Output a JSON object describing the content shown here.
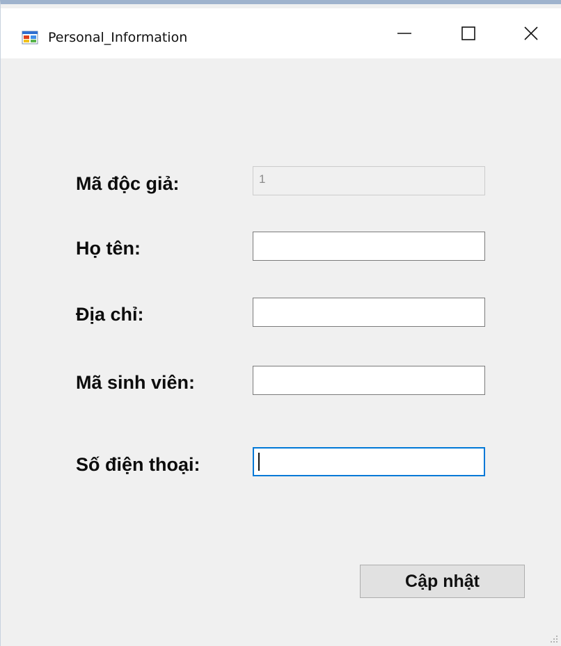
{
  "window": {
    "title": "Personal_Information",
    "app_icon": "winforms-app-icon",
    "controls": {
      "minimize": "minimize-icon",
      "maximize": "maximize-icon",
      "close": "close-icon"
    }
  },
  "form": {
    "fields": [
      {
        "label": "Mã độc giả:",
        "value": "1",
        "enabled": false
      },
      {
        "label": "Họ tên:",
        "value": "",
        "enabled": true
      },
      {
        "label": "Địa chỉ:",
        "value": "",
        "enabled": true
      },
      {
        "label": "Mã sinh viên:",
        "value": "",
        "enabled": true
      },
      {
        "label": "Số điện thoại:",
        "value": "",
        "enabled": true,
        "focused": true
      }
    ],
    "update_button": "Cập nhật"
  },
  "colors": {
    "accent": "#0078d7",
    "background": "#f0f0f0",
    "titlebar": "#ffffff",
    "button": "#e1e1e1"
  }
}
